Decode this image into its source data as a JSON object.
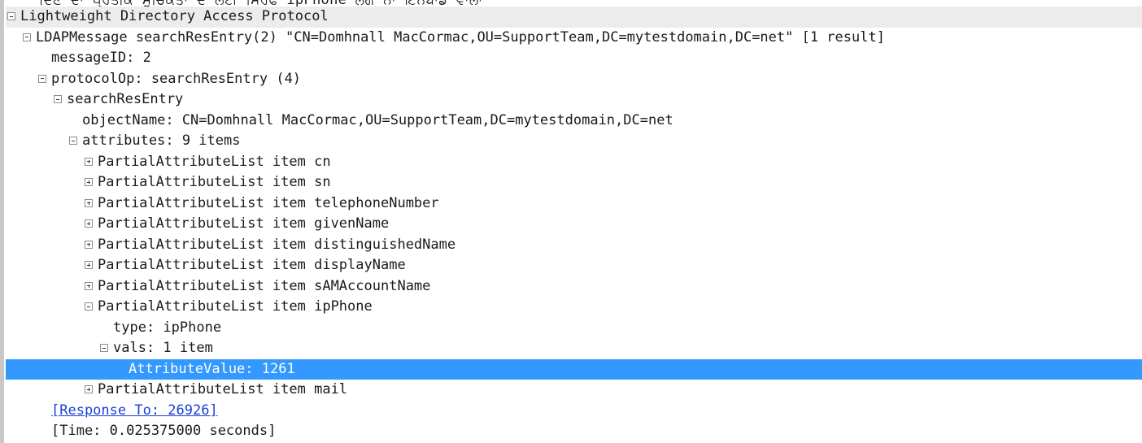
{
  "top_clipped_text": "ਦਿਣ ਦਾ ਪ੍ਰਤੀਕ ਸੂਚਿਕਤਾ ਦੇ ਲਈ ਸਿਰਫ ipPhone ਲੋਗ ਨਾ ਇਨਬਾਂਡ ਵਾਲਾ",
  "tree": {
    "root_label": "Lightweight Directory Access Protocol",
    "message_label": "LDAPMessage searchResEntry(2) \"CN=Domhnall MacCormac,OU=SupportTeam,DC=mytestdomain,DC=net\" [1 result]",
    "message_id": "messageID: 2",
    "protocol_op": "protocolOp: searchResEntry (4)",
    "search_res_entry": "searchResEntry",
    "object_name": "objectName: CN=Domhnall MacCormac,OU=SupportTeam,DC=mytestdomain,DC=net",
    "attributes": "attributes: 9 items",
    "attribute_items": [
      "PartialAttributeList item cn",
      "PartialAttributeList item sn",
      "PartialAttributeList item telephoneNumber",
      "PartialAttributeList item givenName",
      "PartialAttributeList item distinguishedName",
      "PartialAttributeList item displayName",
      "PartialAttributeList item sAMAccountName"
    ],
    "ipphone_item": "PartialAttributeList item ipPhone",
    "ipphone_type": "type: ipPhone",
    "ipphone_vals": "vals: 1 item",
    "attribute_value": "AttributeValue: 1261",
    "mail_item": "PartialAttributeList item mail",
    "response_to": "[Response To: 26926]",
    "time": "[Time: 0.025375000 seconds]"
  },
  "colors": {
    "selection": "#3399ff",
    "link": "#1a3fd8",
    "root_row": "#ececec"
  },
  "icons": {
    "expanded": "minus-box-icon",
    "collapsed": "plus-box-icon"
  }
}
